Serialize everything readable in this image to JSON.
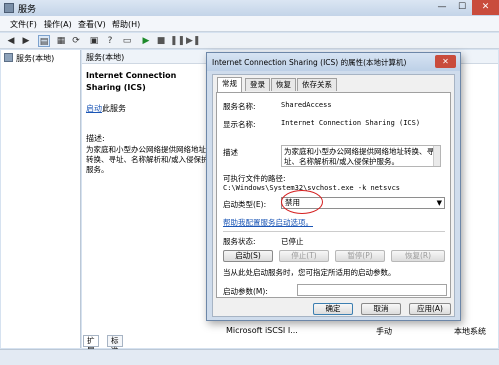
{
  "window": {
    "title": "服务"
  },
  "menu": [
    "文件(F)",
    "操作(A)",
    "查看(V)",
    "帮助(H)"
  ],
  "tree": {
    "item": "服务(本地)"
  },
  "main": {
    "header": "服务(本地)",
    "service_title": "Internet Connection Sharing (ICS)",
    "start_link": "启动",
    "start_rest": "此服务",
    "desc_label": "描述:",
    "desc_body": "为家庭和小型办公网络提供网络地址转换、寻址、名称解析和/或入侵保护服务。",
    "row_name": "Microsoft iSCSI I...",
    "row_type": "手动",
    "row_account": "本地系统"
  },
  "bottom_tabs": [
    "扩展",
    "标准"
  ],
  "dialog": {
    "title": "Internet Connection Sharing (ICS) 的属性(本地计算机)",
    "tabs": [
      "常规",
      "登录",
      "恢复",
      "依存关系"
    ],
    "service_name_label": "服务名称:",
    "service_name": "SharedAccess",
    "display_name_label": "显示名称:",
    "display_name": "Internet Connection Sharing (ICS)",
    "desc_label": "描述",
    "desc_text": "为家庭和小型办公网络提供网络地址转换、寻址、名称解析和/或入侵保护服务。",
    "exe_label": "可执行文件的路径:",
    "exe_path": "C:\\Windows\\System32\\svchost.exe -k netsvcs",
    "startup_type_label": "启动类型(E):",
    "startup_type_value": "禁用",
    "help_link": "帮助我配置服务启动选项。",
    "status_label": "服务状态:",
    "status_value": "已停止",
    "btn_start": "启动(S)",
    "btn_stop": "停止(T)",
    "btn_pause": "暂停(P)",
    "btn_resume": "恢复(R)",
    "params_hint": "当从此处启动服务时，您可指定所适用的启动参数。",
    "params_label": "启动参数(M):",
    "btn_ok": "确定",
    "btn_cancel": "取消",
    "btn_apply": "应用(A)"
  }
}
